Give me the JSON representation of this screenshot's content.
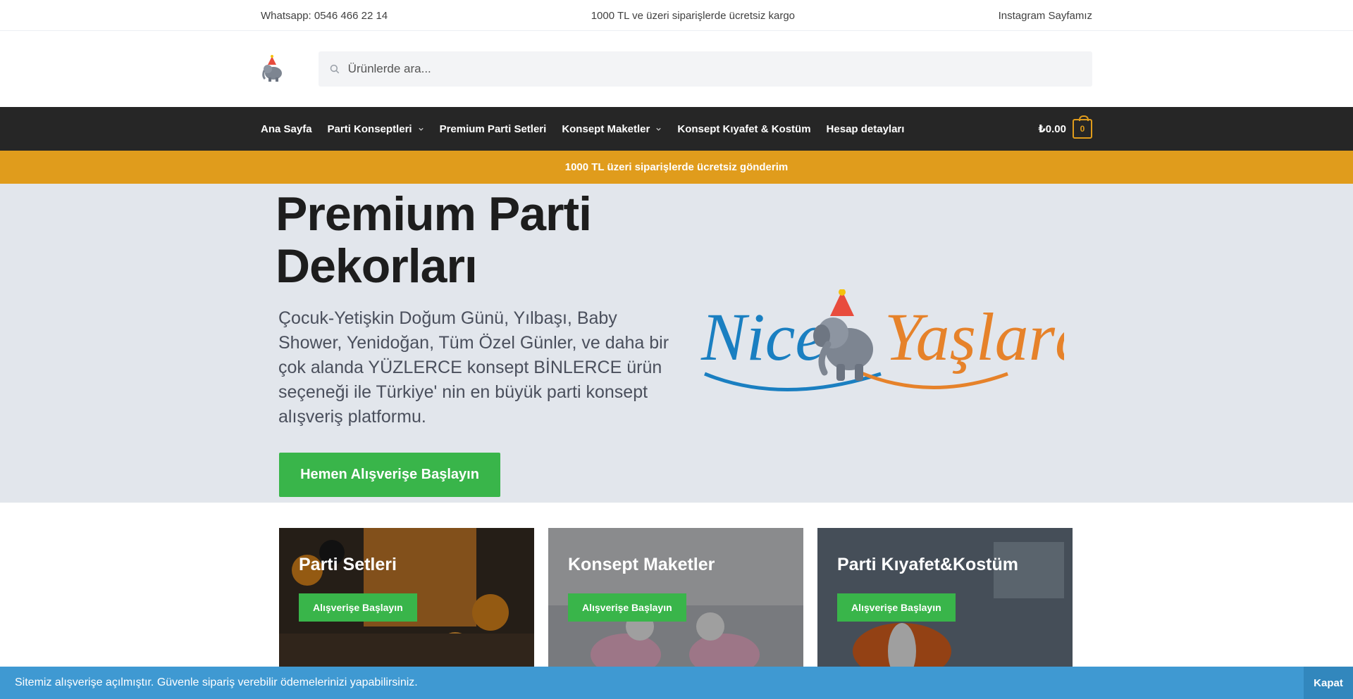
{
  "topbar": {
    "whatsapp": "Whatsapp: 0546 466 22 14",
    "shipping": "1000 TL ve üzeri siparişlerde ücretsiz kargo",
    "instagram": "Instagram Sayfamız"
  },
  "search": {
    "placeholder": "Ürünlerde ara..."
  },
  "nav": {
    "items": [
      {
        "label": "Ana Sayfa"
      },
      {
        "label": "Parti Konseptleri"
      },
      {
        "label": "Premium Parti Setleri"
      },
      {
        "label": "Konsept Maketler"
      },
      {
        "label": "Konsept Kıyafet & Kostüm"
      },
      {
        "label": "Hesap detayları"
      }
    ],
    "cart_total": "₺0.00",
    "cart_count": "0"
  },
  "promo": {
    "text": "1000 TL üzeri siparişlerde ücretsiz gönderim"
  },
  "hero": {
    "title_line1": "Premium Parti",
    "title_line2": "Dekorları",
    "description": "Çocuk-Yetişkin Doğum Günü, Yılbaşı, Baby Shower, Yenidoğan, Tüm Özel Günler, ve daha bir çok alanda YÜZLERCE konsept BİNLERCE ürün seçeneği ile Türkiye' nin en büyük parti konsept alışveriş platformu.",
    "cta": "Hemen Alışverişe Başlayın",
    "logo_text_left": "Nice",
    "logo_text_right": "Yaşlara"
  },
  "cards": [
    {
      "title": "Parti Setleri",
      "button": "Alışverişe Başlayın"
    },
    {
      "title": "Konsept Maketler",
      "button": "Alışverişe Başlayın"
    },
    {
      "title": "Parti Kıyafet&Kostüm",
      "button": "Alışverişe Başlayın"
    }
  ],
  "notice": {
    "text": "Sitemiz alışverişe açılmıştır. Güvenle sipariş verebilir ödemelerinizi yapabilirsiniz.",
    "close": "Kapat"
  },
  "colors": {
    "accent": "#e09c1c",
    "nav_bg": "#262626",
    "hero_bg": "#e2e6ec",
    "button_green": "#39b54a",
    "notice_blue": "#3f99d2"
  }
}
